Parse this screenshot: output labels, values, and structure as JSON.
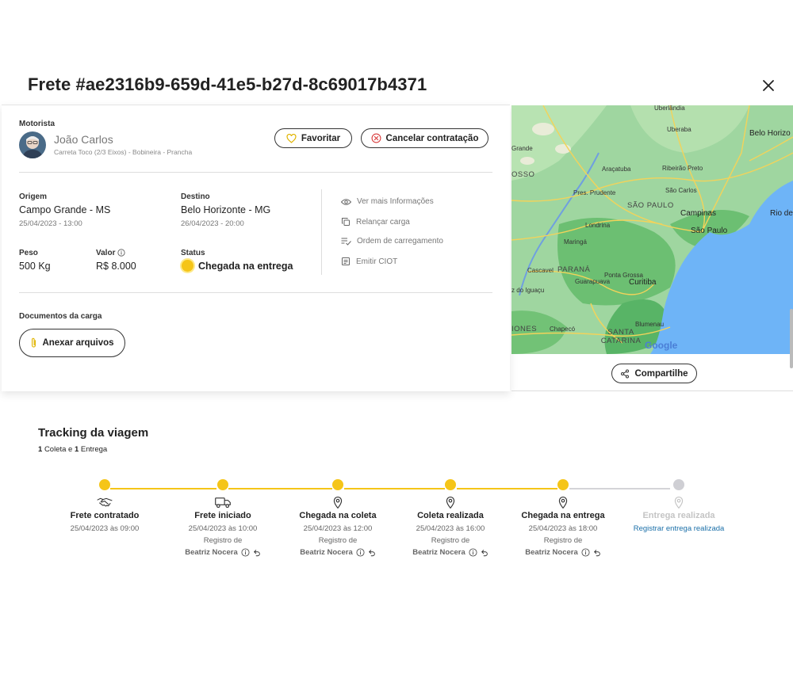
{
  "header": {
    "title": "Frete #ae2316b9-659d-41e5-b27d-8c69017b4371"
  },
  "driver": {
    "section_label": "Motorista",
    "name": "João Carlos",
    "vehicle": "Carreta Toco (2/3 Eixos) - Bobineira - Prancha"
  },
  "buttons": {
    "favorite": "Favoritar",
    "cancel": "Cancelar contratação",
    "attach": "Anexar arquivos",
    "share": "Compartilhe"
  },
  "origin": {
    "label": "Origem",
    "city": "Campo Grande - MS",
    "datetime": "25/04/2023 - 13:00"
  },
  "destination": {
    "label": "Destino",
    "city": "Belo Horizonte - MG",
    "datetime": "26/04/2023  - 20:00"
  },
  "weight": {
    "label": "Peso",
    "value": "500 Kg"
  },
  "price": {
    "label": "Valor",
    "value": "R$ 8.000"
  },
  "status": {
    "label": "Status",
    "value": "Chegada na entrega",
    "color": "#f5c518"
  },
  "actions": [
    {
      "label": "Ver mais Informações",
      "icon": "eye-icon"
    },
    {
      "label": "Relançar carga",
      "icon": "copy-icon"
    },
    {
      "label": "Ordem de carregamento",
      "icon": "list-check-icon"
    },
    {
      "label": "Emitir CIOT",
      "icon": "document-icon"
    }
  ],
  "documents": {
    "label": "Documentos da carga"
  },
  "map": {
    "labels": {
      "uberlandia": "Uberlândia",
      "uberaba": "Uberaba",
      "belo_horizonte": "Belo Horizo",
      "grande": "Grande",
      "osso": "OSSO",
      "aracatuba": "Araçatuba",
      "ribeirao_preto": "Ribeirão Preto",
      "pres_prudente": "Pres. Prudente",
      "sao_carlos": "São Carlos",
      "sao_paulo_state": "SÃO PAULO",
      "campinas": "Campinas",
      "sao_paulo_city": "São Paulo",
      "rio": "Rio de",
      "londrina": "Londrina",
      "maringa": "Maringá",
      "cascavel": "Cascavel",
      "parana": "PARANÁ",
      "ponta_grossa": "Ponta Grossa",
      "guarapuava": "Guarapuava",
      "curitiba": "Curitiba",
      "iguacu": "z do Iguaçu",
      "iones": "IONES",
      "chapeco": "Chapecó",
      "santa_catarina": "SANTA CATARINA",
      "blumenau": "Blumenau",
      "google": "Google"
    },
    "colors": {
      "land": "#9fd6a0",
      "sea": "#6eb4f7",
      "road": "#f3d35a",
      "dark_green": "#58b466"
    }
  },
  "tracking": {
    "title": "Tracking da viagem",
    "summary_prefix_count": "1",
    "summary_pickup": "Coleta e",
    "summary_delivery_count": "1",
    "summary_delivery": "Entrega",
    "steps": [
      {
        "label": "Frete contratado",
        "date": "25/04/2023 às 09:00",
        "icon": "handshake-icon",
        "done": true
      },
      {
        "label": "Frete iniciado",
        "date": "25/04/2023 às 10:00",
        "registered": "Registro de",
        "by": "Beatriz Nocera",
        "icon": "truck-icon",
        "done": true
      },
      {
        "label": "Chegada na coleta",
        "date": "25/04/2023 às 12:00",
        "registered": "Registro de",
        "by": "Beatriz Nocera",
        "icon": "pin-icon",
        "done": true
      },
      {
        "label": "Coleta realizada",
        "date": "25/04/2023 às 16:00",
        "registered": "Registro de",
        "by": "Beatriz Nocera",
        "icon": "pin-icon",
        "done": true
      },
      {
        "label": "Chegada na entrega",
        "date": "25/04/2023 às 18:00",
        "registered": "Registro de",
        "by": "Beatriz Nocera",
        "icon": "pin-icon",
        "done": true
      },
      {
        "label": "Entrega realizada",
        "link": "Registrar entrega realizada",
        "icon": "pin-icon",
        "done": false
      }
    ]
  }
}
